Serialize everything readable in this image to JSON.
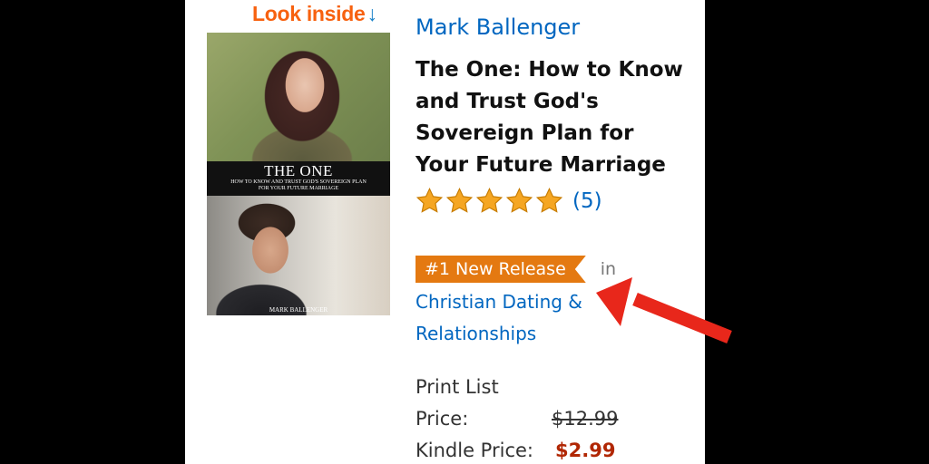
{
  "look_inside": {
    "label": "Look inside",
    "arrow_glyph": "↓"
  },
  "cover": {
    "title": "THE ONE",
    "subtitle": "HOW TO KNOW AND TRUST GOD'S SOVEREIGN PLAN FOR YOUR FUTURE MARRIAGE",
    "author": "MARK BALLENGER"
  },
  "product": {
    "author": "Mark Ballenger",
    "title": "The One: How to Know and Trust God's Sovereign Plan for Your Future Marriage",
    "rating": {
      "stars": 5,
      "count_label": "(5)"
    },
    "badge": {
      "label": "#1 New Release",
      "in_label": "in",
      "category": "Christian Dating & Relationships"
    },
    "prices": {
      "print_label": "Print List Price:",
      "print_value": "$12.99",
      "kindle_label": "Kindle Price:",
      "kindle_value": "$2.99"
    }
  },
  "colors": {
    "link": "#0066c0",
    "badge": "#e47911",
    "price": "#b12704",
    "star": "#f5a623",
    "annotation": "#e8271b"
  }
}
